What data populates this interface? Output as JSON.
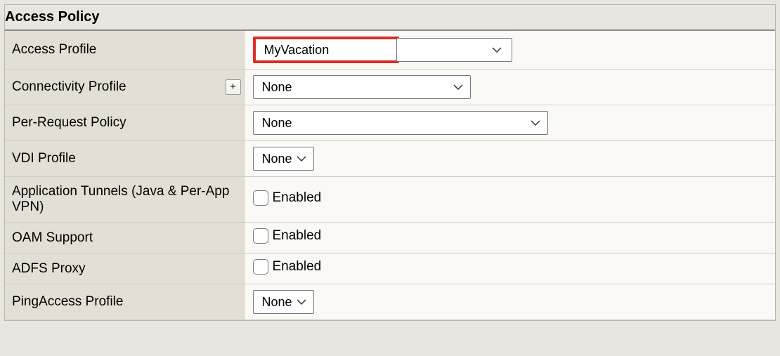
{
  "panel": {
    "title": "Access Policy"
  },
  "rows": {
    "access_profile": {
      "label": "Access Profile",
      "value": "MyVacation"
    },
    "connectivity_profile": {
      "label": "Connectivity Profile",
      "value": "None",
      "add": "+"
    },
    "per_request_policy": {
      "label": "Per-Request Policy",
      "value": "None"
    },
    "vdi_profile": {
      "label": "VDI Profile",
      "value": "None"
    },
    "app_tunnels": {
      "label": "Application Tunnels (Java & Per-App VPN)",
      "checkbox_label": "Enabled"
    },
    "oam_support": {
      "label": "OAM Support",
      "checkbox_label": "Enabled"
    },
    "adfs_proxy": {
      "label": "ADFS Proxy",
      "checkbox_label": "Enabled"
    },
    "pingaccess_profile": {
      "label": "PingAccess Profile",
      "value": "None"
    }
  }
}
